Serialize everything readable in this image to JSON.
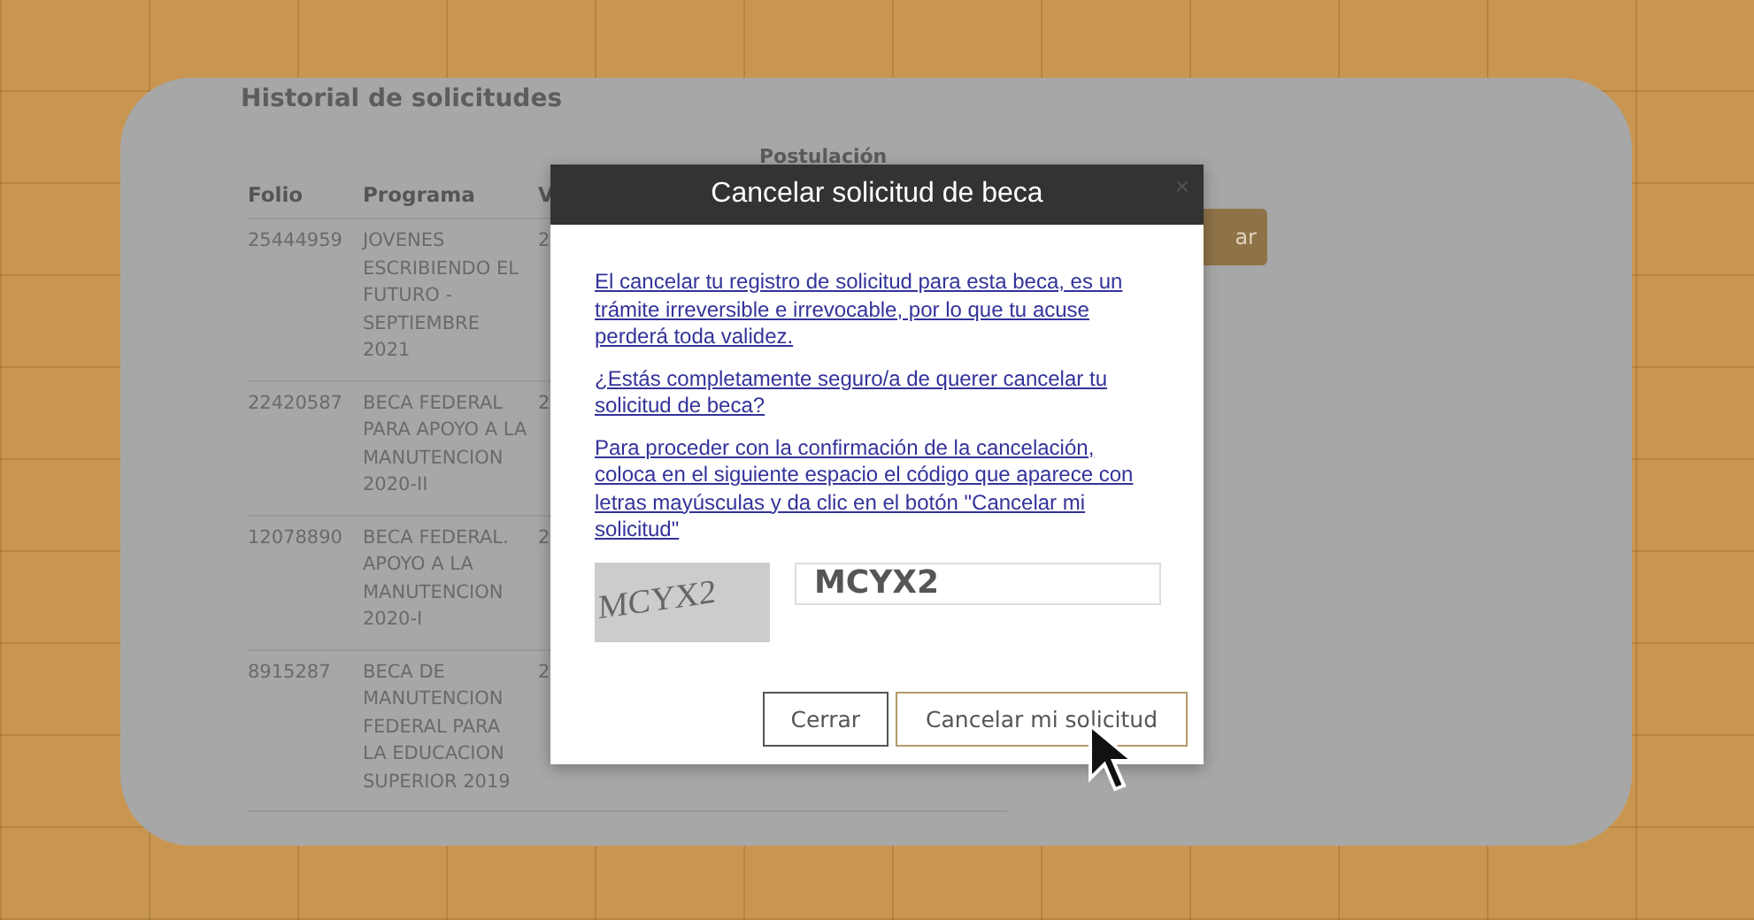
{
  "page": {
    "title": "Historial de solicitudes"
  },
  "table": {
    "group_header": "Postulación",
    "columns": [
      "Folio",
      "Programa",
      "V"
    ],
    "rows": [
      {
        "folio": "25444959",
        "programa": "JOVENES ESCRIBIENDO EL FUTURO - SEPTIEMBRE 2021",
        "column_3": "2"
      },
      {
        "folio": "22420587",
        "programa": "BECA FEDERAL PARA APOYO A LA MANUTENCION 2020-II",
        "column_3": "2"
      },
      {
        "folio": "12078890",
        "programa": "BECA FEDERAL. APOYO A LA MANUTENCION 2020-I",
        "column_3": "2"
      },
      {
        "folio": "8915287",
        "programa": "BECA DE MANUTENCION FEDERAL PARA LA EDUCACION SUPERIOR 2019",
        "column_3": "2"
      }
    ]
  },
  "side_button": {
    "label": "ar"
  },
  "dialog": {
    "title": "Cancelar solicitud de beca",
    "close": "×",
    "paragraphs": [
      "El cancelar tu registro de solicitud para esta beca, es un trámite irreversible e irrevocable, por lo que tu acuse perderá toda validez.",
      "¿Estás completamente seguro/a de querer cancelar tu solicitud de beca?",
      "Para proceder con la confirmación de la cancelación, coloca en el siguiente espacio el código que aparece con letras mayúsculas y da clic en el botón \"Cancelar mi solicitud\""
    ],
    "captcha": "MCYX2",
    "code_field": {
      "value": "MCYX2"
    },
    "buttons": [
      {
        "label": "Cerrar",
        "kind": "secondary"
      },
      {
        "label": "Cancelar mi solicitud",
        "kind": "primary"
      }
    ]
  }
}
